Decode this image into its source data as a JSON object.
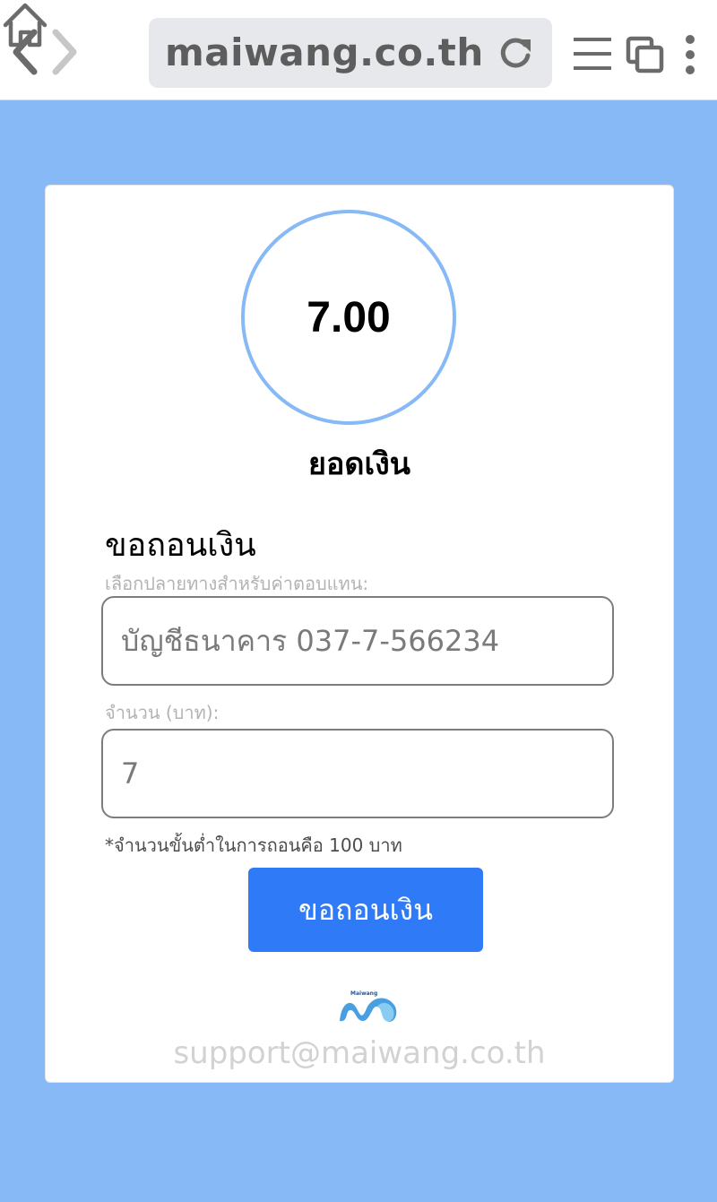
{
  "browser": {
    "url": "maiwang.co.th",
    "icons": {
      "back": "chevron-left-icon",
      "forward": "chevron-right-icon",
      "home": "home-icon",
      "reload": "reload-icon",
      "menu": "hamburger-menu-icon",
      "tabs": "tabs-icon",
      "more": "more-vertical-icon"
    }
  },
  "balance": {
    "value": "7.00",
    "label": "ยอดเงิน"
  },
  "withdraw": {
    "title": "ขอถอนเงิน",
    "destination_label": "เลือกปลายทางสำหรับค่าตอบแทน:",
    "destination_value": "บัญชีธนาคาร 037-7-566234",
    "amount_label": "จำนวน (บาท):",
    "amount_value": "7",
    "note": "*จำนวนขั้นต่ำในการถอนคือ 100 บาท",
    "submit_label": "ขอถอนเงิน"
  },
  "footer": {
    "logo_text": "Maiwang",
    "support_email": "support@maiwang.co.th"
  },
  "colors": {
    "page_background": "#86b9f6",
    "accent_button": "#2f7bf7",
    "circle_border": "#86b9f6"
  }
}
